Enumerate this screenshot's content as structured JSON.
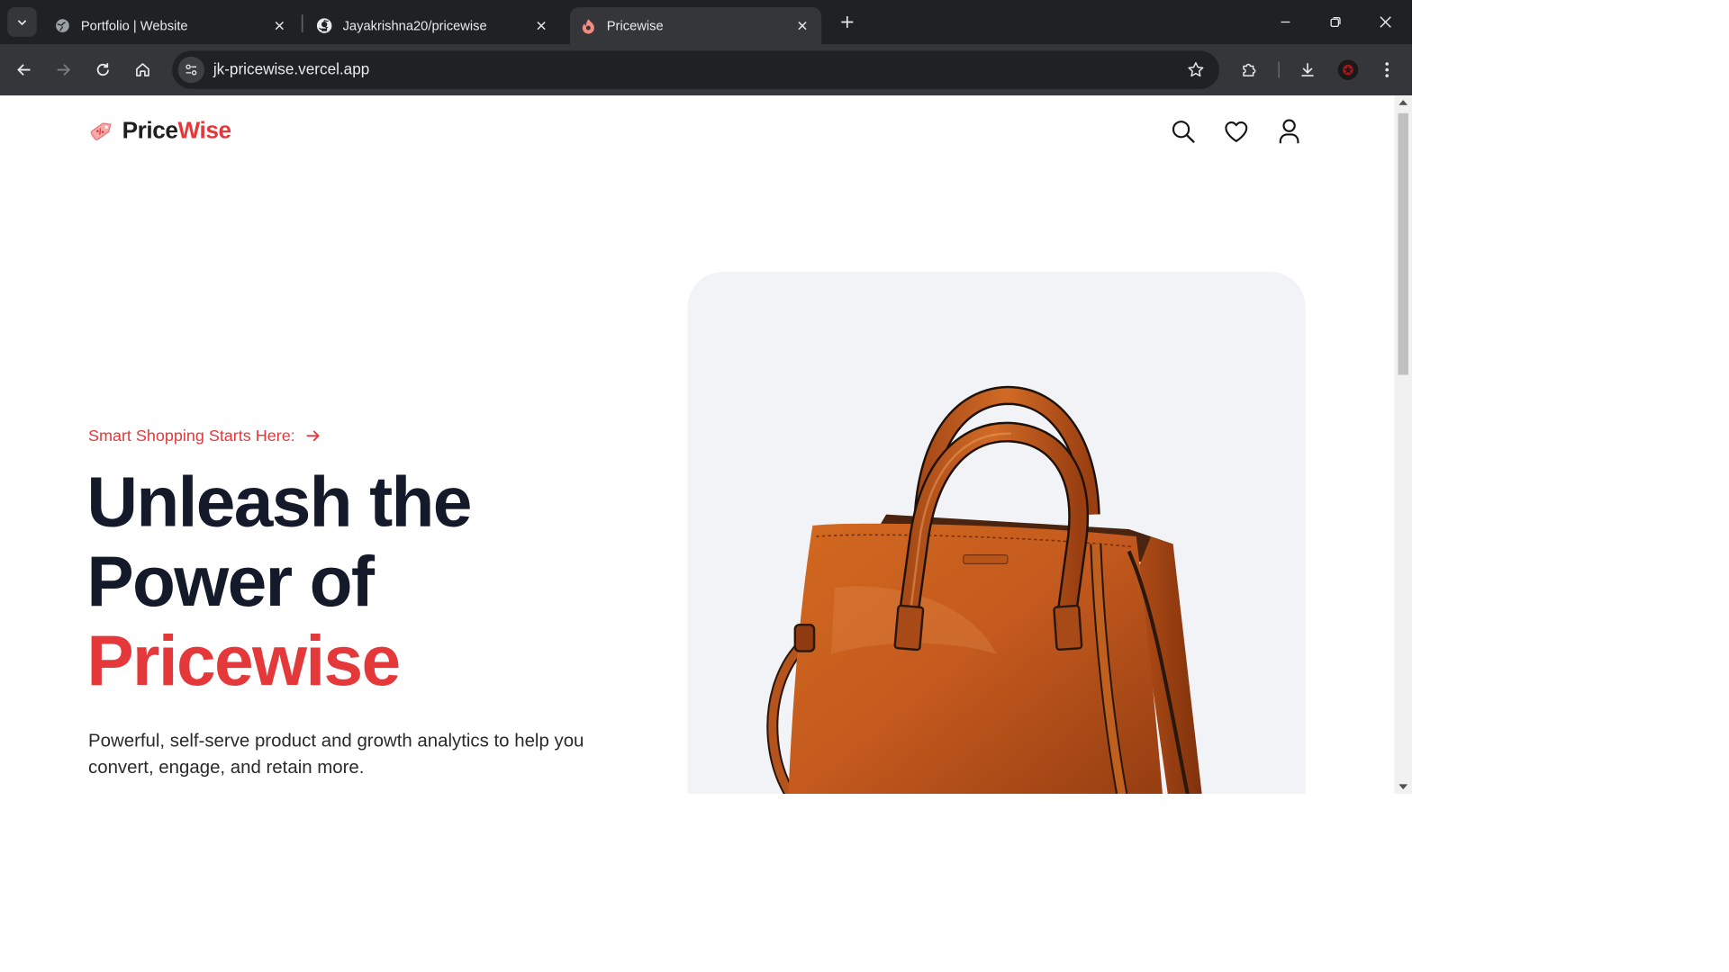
{
  "browser": {
    "tabs": [
      {
        "title": "Portfolio | Website",
        "active": false
      },
      {
        "title": "Jayakrishna20/pricewise",
        "active": false
      },
      {
        "title": "Pricewise",
        "active": true
      }
    ],
    "url": "jk-pricewise.vercel.app"
  },
  "header": {
    "logo_part1": "Price",
    "logo_part2": "Wise"
  },
  "hero": {
    "tagline": "Smart Shopping Starts Here:",
    "headline_line1": "Unleash the",
    "headline_line2": "Power of",
    "headline_line3": "Pricewise",
    "subtext": "Powerful, self-serve product and growth analytics to help you convert, engage, and retain more."
  },
  "colors": {
    "accent": "#e5383b",
    "heading": "#141a29",
    "card_bg": "#f2f3f6",
    "bag": "#c45a1e"
  },
  "icons": {
    "header": [
      "search-icon",
      "heart-icon",
      "user-icon"
    ],
    "hero_image": "leather-handbag-image"
  }
}
